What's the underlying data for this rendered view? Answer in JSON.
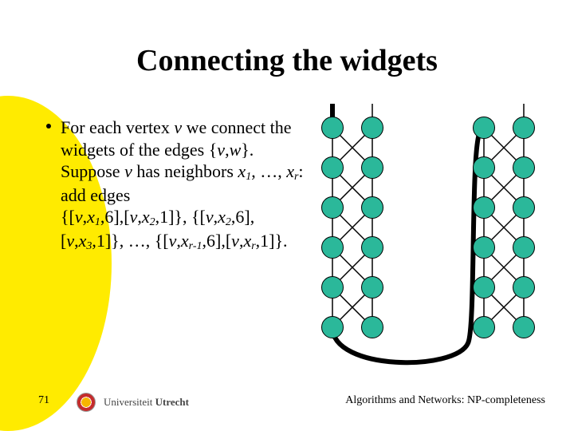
{
  "title": "Connecting the widgets",
  "bullet": {
    "parts": [
      "For each vertex ",
      " we connect the widgets of the edges {",
      ",",
      "}. Suppose ",
      " has neighbors ",
      ", …, ",
      ": add edges",
      "{[",
      ",",
      ",6],[",
      ",",
      ",1]}, {[",
      ",",
      ",6],[",
      ",",
      ",1]}, …, {[",
      ",",
      ",6],[",
      ",",
      ",1]}."
    ],
    "v": "v",
    "w": "w",
    "x": "x",
    "s1": "1",
    "s2": "2",
    "s3": "3",
    "srm1": "r-1",
    "sr": "r"
  },
  "footer": {
    "page": "71",
    "uni_prefix": "Universiteit",
    "uni_name": "Utrecht",
    "course": "Algorithms and Networks: NP-completeness"
  }
}
